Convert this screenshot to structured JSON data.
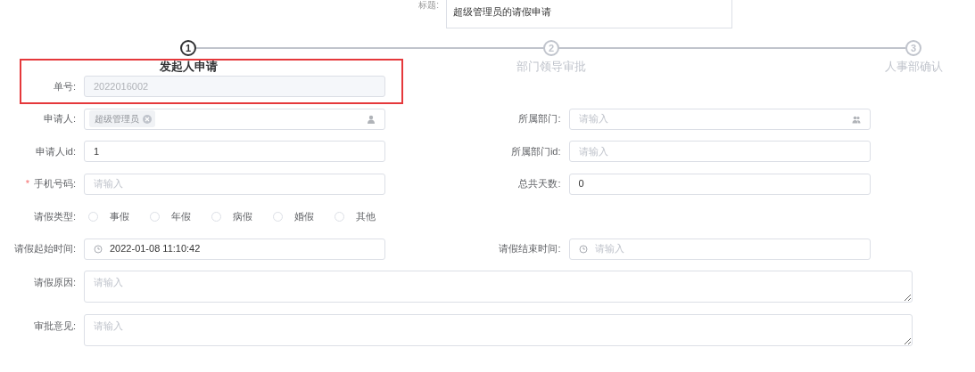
{
  "header": {
    "title_label": "标题:",
    "title_value": "超级管理员的请假申请"
  },
  "steps": [
    {
      "number": "1",
      "label": "发起人申请",
      "selected": true
    },
    {
      "number": "2",
      "label": "部门领导审批",
      "selected": false
    },
    {
      "number": "3",
      "label": "人事部确认",
      "selected": false
    }
  ],
  "form": {
    "rows": [
      {
        "fields": [
          {
            "kind": "text",
            "label": "单号:",
            "value": "2022016002",
            "disabled": true
          }
        ]
      },
      {
        "fields": [
          {
            "kind": "user-picker",
            "label": "申请人:",
            "tags": [
              "超级管理员"
            ]
          },
          {
            "kind": "dept-picker",
            "label": "所属部门:",
            "placeholder": "请输入"
          }
        ]
      },
      {
        "fields": [
          {
            "kind": "text",
            "label": "申请人id:",
            "value": "1"
          },
          {
            "kind": "text",
            "label": "所属部门id:",
            "placeholder": "请输入"
          }
        ]
      },
      {
        "fields": [
          {
            "kind": "text",
            "label": "手机号码:",
            "required_mark": "*",
            "placeholder": "请输入"
          },
          {
            "kind": "text",
            "label": "总共天数:",
            "value": "0"
          }
        ]
      },
      {
        "fields": [
          {
            "kind": "radio",
            "label": "请假类型:",
            "options": [
              {
                "label": "事假",
                "selected": false
              },
              {
                "label": "年假",
                "selected": false
              },
              {
                "label": "病假",
                "selected": false
              },
              {
                "label": "婚假",
                "selected": false
              },
              {
                "label": "其他",
                "selected": false
              }
            ]
          }
        ]
      },
      {
        "fields": [
          {
            "kind": "datetime",
            "label": "请假起始时间:",
            "value": "2022-01-08 11:10:42"
          },
          {
            "kind": "datetime",
            "label": "请假结束时间:",
            "placeholder": "请输入"
          }
        ]
      },
      {
        "fields": [
          {
            "kind": "textarea",
            "label": "请假原因:",
            "placeholder": "请输入"
          }
        ]
      },
      {
        "fields": [
          {
            "kind": "textarea",
            "label": "审批意见:",
            "placeholder": "请输入"
          }
        ]
      }
    ]
  }
}
